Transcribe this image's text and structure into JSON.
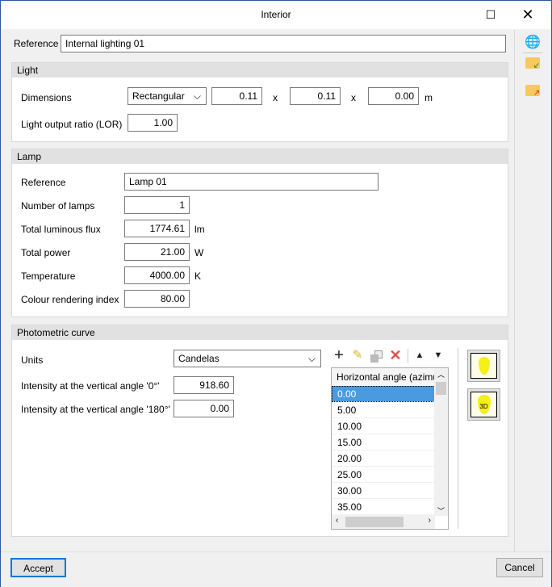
{
  "window": {
    "title": "Interior"
  },
  "reference": {
    "label": "Reference",
    "value": "Internal lighting 01"
  },
  "light": {
    "title": "Light",
    "dimensions_label": "Dimensions",
    "shape": "Rectangular",
    "dim1": "0.11",
    "x1": "x",
    "dim2": "0.11",
    "x2": "x",
    "dim3": "0.00",
    "unit": "m",
    "lor_label": "Light output ratio (LOR)",
    "lor": "1.00"
  },
  "lamp": {
    "title": "Lamp",
    "reference_label": "Reference",
    "reference": "Lamp 01",
    "num_label": "Number of lamps",
    "num": "1",
    "flux_label": "Total luminous flux",
    "flux": "1774.61",
    "flux_unit": "lm",
    "power_label": "Total power",
    "power": "21.00",
    "power_unit": "W",
    "temp_label": "Temperature",
    "temp": "4000.00",
    "temp_unit": "K",
    "cri_label": "Colour rendering index",
    "cri": "80.00"
  },
  "photometric": {
    "title": "Photometric curve",
    "units_label": "Units",
    "units": "Candelas",
    "int0_label": "Intensity at the vertical angle '0°'",
    "int0": "918.60",
    "int180_label": "Intensity at the vertical angle '180°'",
    "int180": "0.00",
    "column_header": "Horizontal angle (azimu",
    "rows": [
      "0.00",
      "5.00",
      "10.00",
      "15.00",
      "20.00",
      "25.00",
      "30.00",
      "35.00"
    ],
    "selected_row": 0
  },
  "footer": {
    "accept": "Accept",
    "cancel": "Cancel"
  }
}
